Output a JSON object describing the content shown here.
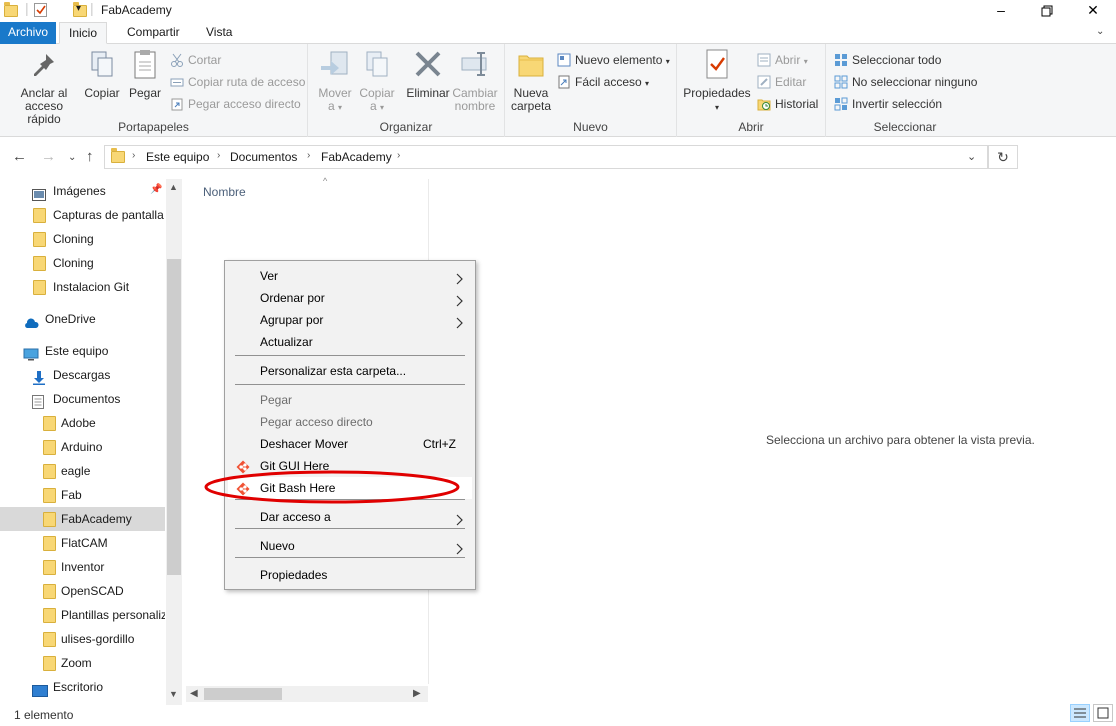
{
  "window": {
    "title": "FabAcademy"
  },
  "ribbon_tabs": [
    {
      "label": "Archivo"
    },
    {
      "label": "Inicio"
    },
    {
      "label": "Compartir"
    },
    {
      "label": "Vista"
    }
  ],
  "ribbon": {
    "portapapeles": {
      "label": "Portapapeles",
      "pin": "Anclar al\nacceso rápido",
      "pin_line1": "Anclar al",
      "pin_line2": "acceso rápido",
      "copy": "Copiar",
      "paste": "Pegar",
      "cut": "Cortar",
      "copy_path": "Copiar ruta de acceso",
      "paste_shortcut": "Pegar acceso directo"
    },
    "organizar": {
      "label": "Organizar",
      "move_line1": "Mover",
      "move_line2": "a",
      "copy_line1": "Copiar",
      "copy_line2": "a",
      "delete": "Eliminar",
      "rename_line1": "Cambiar",
      "rename_line2": "nombre"
    },
    "nuevo": {
      "label": "Nuevo",
      "new_folder_line1": "Nueva",
      "new_folder_line2": "carpeta",
      "new_item": "Nuevo elemento",
      "easy_access": "Fácil acceso"
    },
    "abrir": {
      "label": "Abrir",
      "properties": "Propiedades",
      "open": "Abrir",
      "edit": "Editar",
      "history": "Historial"
    },
    "seleccionar": {
      "label": "Seleccionar",
      "select_all": "Seleccionar todo",
      "select_none": "No seleccionar ninguno",
      "invert": "Invertir selección"
    }
  },
  "address": {
    "crumbs": [
      "Este equipo",
      "Documentos",
      "FabAcademy"
    ]
  },
  "sidebar": {
    "items": [
      {
        "label": "Imágenes",
        "icon": "pictures-icon"
      },
      {
        "label": "Capturas de pantalla",
        "icon": "folder-icon"
      },
      {
        "label": "Cloning",
        "icon": "folder-icon"
      },
      {
        "label": "Cloning",
        "icon": "folder-icon"
      },
      {
        "label": "Instalacion Git",
        "icon": "folder-icon"
      },
      {
        "label": "OneDrive",
        "icon": "onedrive-icon"
      },
      {
        "label": "Este equipo",
        "icon": "computer-icon"
      },
      {
        "label": "Descargas",
        "icon": "download-icon"
      },
      {
        "label": "Documentos",
        "icon": "documents-icon"
      },
      {
        "label": "Adobe",
        "icon": "folder-icon"
      },
      {
        "label": "Arduino",
        "icon": "folder-icon"
      },
      {
        "label": "eagle",
        "icon": "folder-icon"
      },
      {
        "label": "Fab",
        "icon": "folder-icon"
      },
      {
        "label": "FabAcademy",
        "icon": "folder-icon",
        "selected": true
      },
      {
        "label": "FlatCAM",
        "icon": "folder-icon"
      },
      {
        "label": "Inventor",
        "icon": "folder-icon"
      },
      {
        "label": "OpenSCAD",
        "icon": "folder-icon"
      },
      {
        "label": "Plantillas personaliz",
        "icon": "folder-icon"
      },
      {
        "label": "ulises-gordillo",
        "icon": "folder-icon"
      },
      {
        "label": "Zoom",
        "icon": "folder-icon"
      },
      {
        "label": "Escritorio",
        "icon": "desktop-icon"
      }
    ]
  },
  "content": {
    "column_header": "Nombre",
    "preview_text": "Selecciona un archivo para obtener la vista previa."
  },
  "context_menu": {
    "items": [
      {
        "label": "Ver",
        "submenu": true
      },
      {
        "label": "Ordenar por",
        "submenu": true
      },
      {
        "label": "Agrupar por",
        "submenu": true
      },
      {
        "label": "Actualizar"
      },
      {
        "label": "Personalizar esta carpeta..."
      },
      {
        "label": "Pegar",
        "disabled": true
      },
      {
        "label": "Pegar acceso directo",
        "disabled": true
      },
      {
        "label": "Deshacer Mover",
        "shortcut": "Ctrl+Z"
      },
      {
        "label": "Git GUI Here",
        "icon": "git-icon"
      },
      {
        "label": "Git Bash Here",
        "icon": "git-icon",
        "highlighted": true
      },
      {
        "label": "Dar acceso a",
        "submenu": true
      },
      {
        "label": "Nuevo",
        "submenu": true
      },
      {
        "label": "Propiedades"
      }
    ]
  },
  "status": {
    "count": "1 elemento"
  },
  "colors": {
    "accent": "#1979ca",
    "annotation": "#e00000",
    "folder": "#f8d775"
  }
}
